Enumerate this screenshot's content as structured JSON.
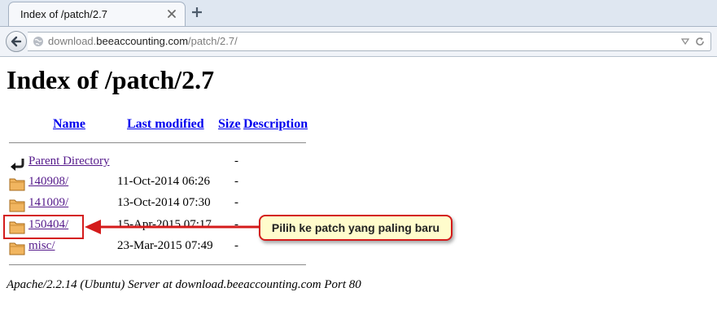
{
  "browser": {
    "tab_title": "Index of /patch/2.7",
    "url_prefix": "download.",
    "url_domain": "beeaccounting.com",
    "url_path": "/patch/2.7/"
  },
  "page": {
    "heading": "Index of /patch/2.7",
    "columns": [
      "Name",
      "Last modified",
      "Size",
      "Description"
    ],
    "rows": [
      {
        "name": "Parent Directory",
        "modified": "",
        "size": "-",
        "icon": "back-arrow-icon"
      },
      {
        "name": "140908/",
        "modified": "11-Oct-2014 06:26",
        "size": "-",
        "icon": "folder-icon"
      },
      {
        "name": "141009/",
        "modified": "13-Oct-2014 07:30",
        "size": "-",
        "icon": "folder-icon"
      },
      {
        "name": "150404/",
        "modified": "15-Apr-2015 07:17",
        "size": "-",
        "icon": "folder-icon"
      },
      {
        "name": "misc/",
        "modified": "23-Mar-2015 07:49",
        "size": "-",
        "icon": "folder-icon"
      }
    ],
    "footer": "Apache/2.2.14 (Ubuntu) Server at download.beeaccounting.com Port 80"
  },
  "annotation": {
    "callout_text": "Pilih ke patch yang paling baru",
    "accent_color": "#d41b1b",
    "callout_bg": "#fffccc"
  }
}
